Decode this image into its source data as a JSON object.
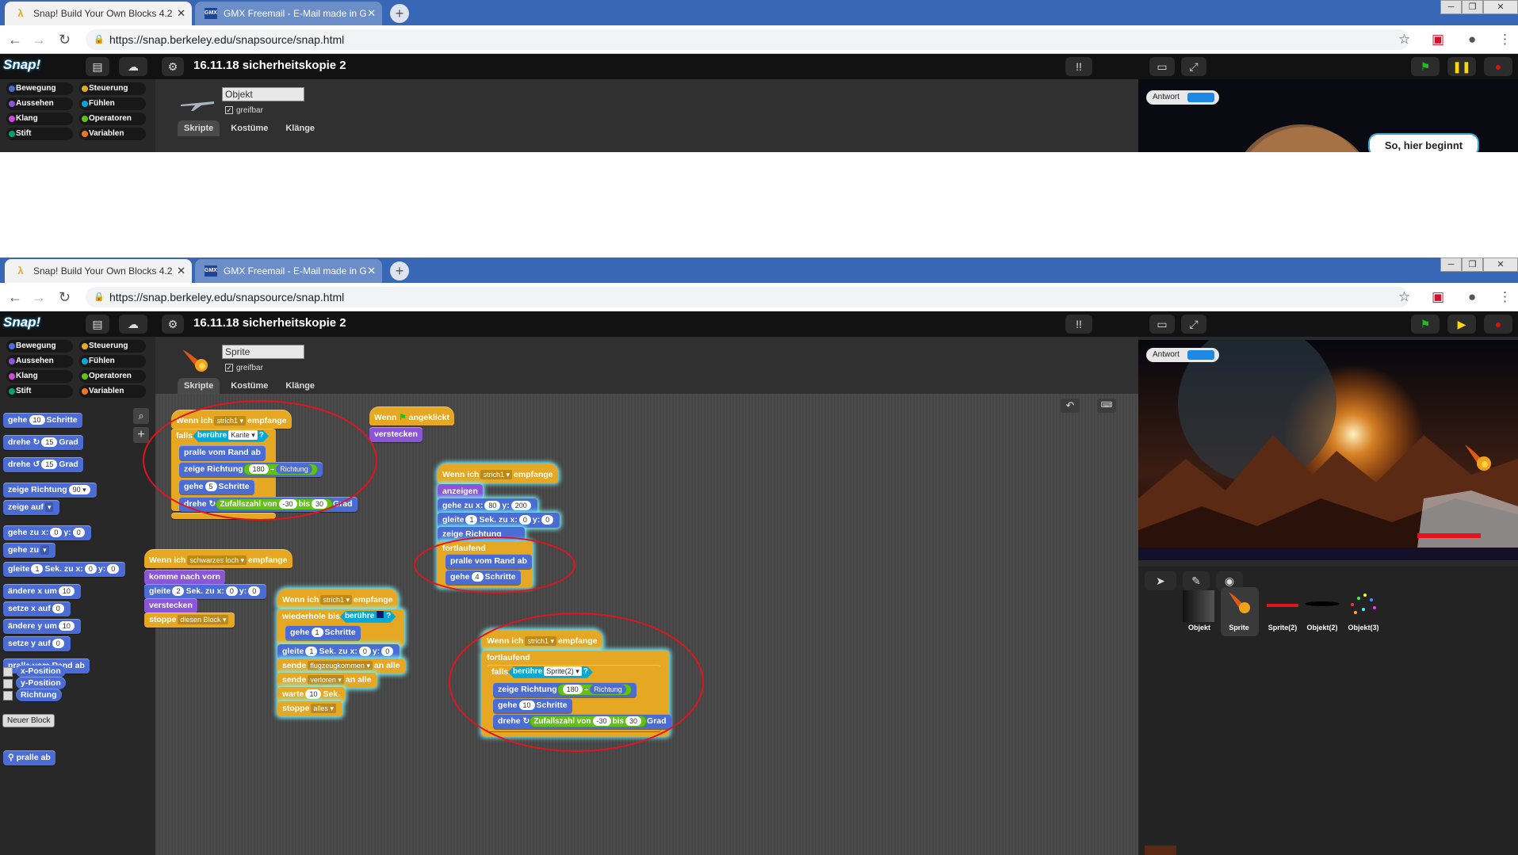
{
  "browser": {
    "tabs": [
      {
        "title": "Snap! Build Your Own Blocks 4.2",
        "icon": "lambda-icon",
        "active": true
      },
      {
        "title": "GMX Freemail - E-Mail made in G",
        "icon": "gmx-icon",
        "active": false
      }
    ],
    "new_tab": "+",
    "url": "https://snap.berkeley.edu/snapsource/snap.html",
    "window_buttons": [
      "─",
      "❐",
      "✕"
    ]
  },
  "snap": {
    "logo": "Snap!",
    "project_title": "16.11.18 sicherheitskopie 2",
    "categories": [
      {
        "label": "Bewegung",
        "color": "#4a6cd4"
      },
      {
        "label": "Aussehen",
        "color": "#8a55d7"
      },
      {
        "label": "Klang",
        "color": "#cf4ad9"
      },
      {
        "label": "Stift",
        "color": "#00a178"
      },
      {
        "label": "Steuerung",
        "color": "#e6a822"
      },
      {
        "label": "Fühlen",
        "color": "#04a8d8"
      },
      {
        "label": "Operatoren",
        "color": "#62c213"
      },
      {
        "label": "Variablen",
        "color": "#f3761d"
      }
    ],
    "editor_tabs": [
      "Skripte",
      "Kostüme",
      "Klänge"
    ],
    "draggable_label": "greifbar",
    "answer_label": "Antwort"
  },
  "shot1": {
    "sprite_name": "Objekt",
    "speech_bubble": "So, hier beginnt"
  },
  "shot2": {
    "sprite_name": "Sprite",
    "palette_blocks": {
      "move_a": "gehe",
      "move_a_val": "10",
      "move_a_tail": "Schritte",
      "turn_r": "drehe ↻",
      "turn_r_val": "15",
      "turn_r_tail": "Grad",
      "turn_l": "drehe ↺",
      "turn_l_val": "15",
      "turn_l_tail": "Grad",
      "point_dir": "zeige Richtung",
      "point_dir_val": "90 ▾",
      "point_to": "zeige auf",
      "goto_xy": "gehe zu x:",
      "goto_xy_x": "0",
      "goto_xy_y_label": "y:",
      "goto_xy_y": "0",
      "goto": "gehe zu",
      "glide": "gleite",
      "glide_s": "1",
      "glide_mid": "Sek. zu x:",
      "glide_x": "0",
      "glide_y_label": "y:",
      "glide_y": "0",
      "change_x": "ändere x um",
      "change_x_val": "10",
      "set_x": "setze x auf",
      "set_x_val": "0",
      "change_y": "ändere y um",
      "change_y_val": "10",
      "set_y": "setze y auf",
      "set_y_val": "0",
      "bounce": "pralle vom Rand ab",
      "xpos": "x-Position",
      "ypos": "y-Position",
      "dir": "Richtung",
      "new_block": "Neuer Block",
      "custom": "⚲ pralle ab"
    },
    "scripts": {
      "s1_hat": "Wenn ich",
      "s1_msg": "strich1 ▾",
      "s1_hat_tail": "empfange",
      "s1_if": "falls",
      "s1_touch": "berühre",
      "s1_touch_obj": "Kante ▾",
      "s1_q": "?",
      "s1_bounce": "pralle vom Rand ab",
      "s1_point": "zeige Richtung",
      "s1_point_a": "180",
      "s1_minus": "–",
      "s1_point_b": "Richtung",
      "s1_move": "gehe",
      "s1_move_val": "5",
      "s1_move_tail": "Schritte",
      "s1_turn": "drehe ↻",
      "s1_rand": "Zufallszahl von",
      "s1_rand_a": "-30",
      "s1_rand_bis": "bis",
      "s1_rand_b": "30",
      "s1_turn_tail": "Grad",
      "s2_hat": "Wenn",
      "s2_hat_tail": "angeklickt",
      "s2_hide": "verstecken",
      "s3_hat": "Wenn ich",
      "s3_msg": "strich1 ▾",
      "s3_hat_tail": "empfange",
      "s3_show": "anzeigen",
      "s3_goto": "gehe zu x:",
      "s3_goto_x": "80",
      "s3_goto_yl": "y:",
      "s3_goto_y": "200",
      "s3_glide": "gleite",
      "s3_glide_s": "1",
      "s3_glide_mid": "Sek. zu x:",
      "s3_glide_x": "0",
      "s3_glide_yl": "y:",
      "s3_glide_y": "0",
      "s3_point": "zeige Richtung",
      "s3_forever": "fortlaufend",
      "s3_bounce": "pralle vom Rand ab",
      "s3_move": "gehe",
      "s3_move_val": "4",
      "s3_move_tail": "Schritte",
      "s4_hat": "Wenn ich",
      "s4_msg": "schwarzes loch ▾",
      "s4_hat_tail": "empfange",
      "s4_front": "komme nach vorn",
      "s4_glide": "gleite",
      "s4_glide_s": "2",
      "s4_glide_mid": "Sek. zu x:",
      "s4_glide_x": "0",
      "s4_glide_yl": "y:",
      "s4_glide_y": "0",
      "s4_hide": "verstecken",
      "s4_stop": "stoppe",
      "s4_stop_opt": "diesen Block ▾",
      "s5_hat": "Wenn ich",
      "s5_msg": "strich1 ▾",
      "s5_hat_tail": "empfange",
      "s5_until": "wiederhole bis",
      "s5_touch": "berühre",
      "s5_q": "?",
      "s5_move": "gehe",
      "s5_move_val": "1",
      "s5_move_tail": "Schritte",
      "s5_glide": "gleite",
      "s5_glide_s": "1",
      "s5_glide_mid": "Sek. zu x:",
      "s5_glide_x": "0",
      "s5_glide_yl": "y:",
      "s5_glide_y": "0",
      "s5_send": "sende",
      "s5_send_msg": "flugzeugkommen ▾",
      "s5_send_tail": "an alle",
      "s5_send2": "sende",
      "s5_send2_msg": "verloren ▾",
      "s5_send2_tail": "an alle",
      "s5_wait": "warte",
      "s5_wait_val": "10",
      "s5_wait_tail": "Sek.",
      "s5_stop": "stoppe",
      "s5_stop_opt": "alles ▾",
      "s6_hat": "Wenn ich",
      "s6_msg": "strich1 ▾",
      "s6_hat_tail": "empfange",
      "s6_forever": "fortlaufend",
      "s6_if": "falls",
      "s6_touch": "berühre",
      "s6_touch_obj": "Sprite(2) ▾",
      "s6_q": "?",
      "s6_point": "zeige Richtung",
      "s6_point_a": "180",
      "s6_minus": "–",
      "s6_point_b": "Richtung",
      "s6_move": "gehe",
      "s6_move_val": "10",
      "s6_move_tail": "Schritte",
      "s6_turn": "drehe ↻",
      "s6_rand": "Zufallszahl von",
      "s6_rand_a": "-30",
      "s6_rand_bis": "bis",
      "s6_rand_b": "30",
      "s6_turn_tail": "Grad"
    },
    "corral": [
      {
        "label": "Objekt"
      },
      {
        "label": "Sprite"
      },
      {
        "label": "Sprite(2)"
      },
      {
        "label": "Objekt(2)"
      },
      {
        "label": "Objekt(3)"
      }
    ]
  }
}
